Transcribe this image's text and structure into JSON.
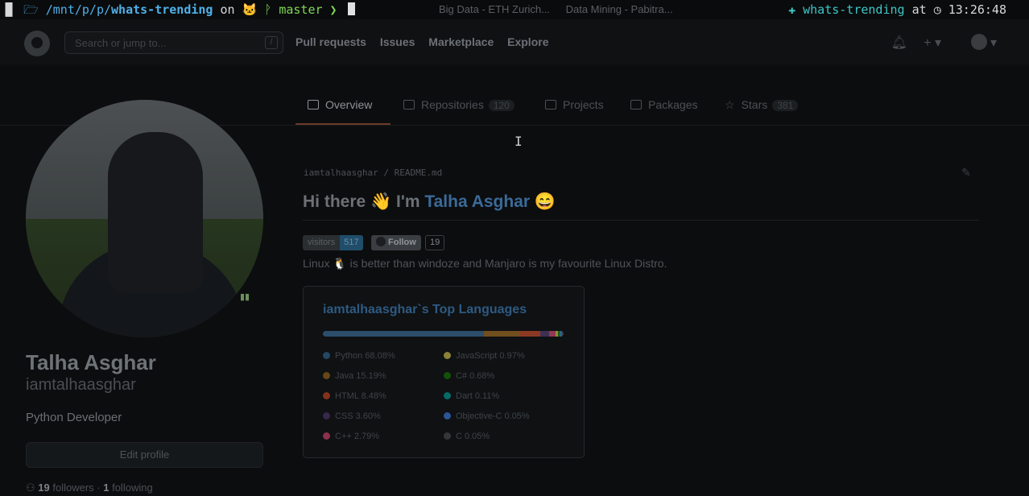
{
  "terminal": {
    "path": "/mnt/p/p/",
    "repo": "whats-trending",
    "on": "on",
    "branch": "master",
    "arrow": "❯",
    "right_repo": "whats-trending",
    "at": "at",
    "time": "13:26:48"
  },
  "browser_tabs": [
    "Big Data - ETH Zurich...",
    "Data Mining - Pabitra..."
  ],
  "header": {
    "search_placeholder": "Search or jump to...",
    "search_key": "/",
    "nav": [
      "Pull requests",
      "Issues",
      "Marketplace",
      "Explore"
    ],
    "bell_icon": "bell-icon",
    "plus_label": "+ ▾"
  },
  "tabs": [
    {
      "label": "Overview",
      "count": ""
    },
    {
      "label": "Repositories",
      "count": "120"
    },
    {
      "label": "Projects",
      "count": ""
    },
    {
      "label": "Packages",
      "count": ""
    },
    {
      "label": "Stars",
      "count": "381"
    }
  ],
  "profile": {
    "name": "Talha Asghar",
    "handle": "iamtalhaasghar",
    "bio": "Python Developer",
    "edit_label": "Edit profile",
    "followers_count": "19",
    "followers_label": "followers",
    "following_count": "1",
    "following_label": "following"
  },
  "readme": {
    "path": "iamtalhaasghar / README.md",
    "title_prefix": "Hi there 👋 I'm ",
    "title_link": "Talha Asghar",
    "title_suffix": " 😄",
    "visitors_label": "visitors",
    "visitors_count": "517",
    "follow_label": "Follow",
    "follow_count": "19",
    "line": "Linux 🐧 is better than windoze and Manjaro is my favourite Linux Distro."
  },
  "languages_card": {
    "title": "iamtalhaasghar`s Top Languages",
    "items": [
      {
        "name": "Python",
        "pct": "68.08%",
        "value": 68.08,
        "color": "#3572A5"
      },
      {
        "name": "Java",
        "pct": "15.19%",
        "value": 15.19,
        "color": "#b07219"
      },
      {
        "name": "HTML",
        "pct": "8.48%",
        "value": 8.48,
        "color": "#e34c26"
      },
      {
        "name": "CSS",
        "pct": "3.60%",
        "value": 3.6,
        "color": "#563d7c"
      },
      {
        "name": "C++",
        "pct": "2.79%",
        "value": 2.79,
        "color": "#f34b7d"
      },
      {
        "name": "JavaScript",
        "pct": "0.97%",
        "value": 0.97,
        "color": "#f1e05a"
      },
      {
        "name": "C#",
        "pct": "0.68%",
        "value": 0.68,
        "color": "#178600"
      },
      {
        "name": "Dart",
        "pct": "0.11%",
        "value": 0.11,
        "color": "#00B4AB"
      },
      {
        "name": "Objective-C",
        "pct": "0.05%",
        "value": 0.05,
        "color": "#438eff"
      },
      {
        "name": "C",
        "pct": "0.05%",
        "value": 0.05,
        "color": "#555555"
      }
    ]
  }
}
